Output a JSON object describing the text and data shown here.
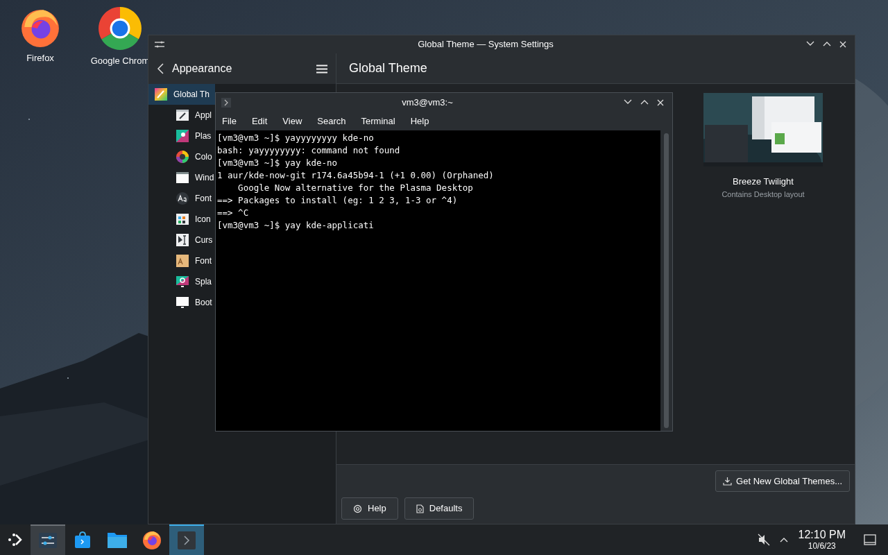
{
  "desktop_icons": [
    {
      "label": "Firefox",
      "kind": "firefox"
    },
    {
      "label": "Google Chrom",
      "kind": "chrome"
    }
  ],
  "settings_window": {
    "title": "Global Theme — System Settings",
    "sidebar_header": "Appearance",
    "page_title": "Global Theme",
    "sidebar_items": [
      {
        "label": "Global Th",
        "selected": true
      },
      {
        "label": "Appl",
        "selected": false
      },
      {
        "label": "Plas",
        "selected": false
      },
      {
        "label": "Colo",
        "selected": false
      },
      {
        "label": "Wind",
        "selected": false
      },
      {
        "label": "Font",
        "selected": false
      },
      {
        "label": "Icon",
        "selected": false
      },
      {
        "label": "Curs",
        "selected": false
      },
      {
        "label": "Font",
        "selected": false
      },
      {
        "label": "Spla",
        "selected": false
      },
      {
        "label": "Boot",
        "selected": false
      }
    ],
    "themes": [
      {
        "name": "Breeze Twilight",
        "subtitle": "Contains Desktop layout"
      }
    ],
    "get_new_button": "Get New Global Themes...",
    "buttons": [
      {
        "label": "Help",
        "kind": "help"
      },
      {
        "label": "Defaults",
        "kind": "defaults"
      }
    ]
  },
  "terminal": {
    "title": "vm3@vm3:~",
    "menu": [
      "File",
      "Edit",
      "View",
      "Search",
      "Terminal",
      "Help"
    ],
    "lines": [
      "[vm3@vm3 ~]$ yayyyyyyyy kde-no",
      "bash: yayyyyyyyy: command not found",
      "[vm3@vm3 ~]$ yay kde-no",
      "1 aur/kde-now-git r174.6a45b94-1 (+1 0.00) (Orphaned)",
      "    Google Now alternative for the Plasma Desktop",
      "==> Packages to install (eg: 1 2 3, 1-3 or ^4)",
      "==> ^C",
      "[vm3@vm3 ~]$ yay kde-applicati"
    ]
  },
  "taskbar": {
    "tasks": [
      {
        "kind": "settings",
        "open": true,
        "selected": false
      },
      {
        "kind": "discover",
        "open": false,
        "selected": false
      },
      {
        "kind": "files",
        "open": false,
        "selected": false
      },
      {
        "kind": "firefox",
        "open": false,
        "selected": false
      },
      {
        "kind": "terminal",
        "open": true,
        "selected": true
      }
    ],
    "clock": {
      "time": "12:10 PM",
      "date": "10/6/23"
    }
  }
}
